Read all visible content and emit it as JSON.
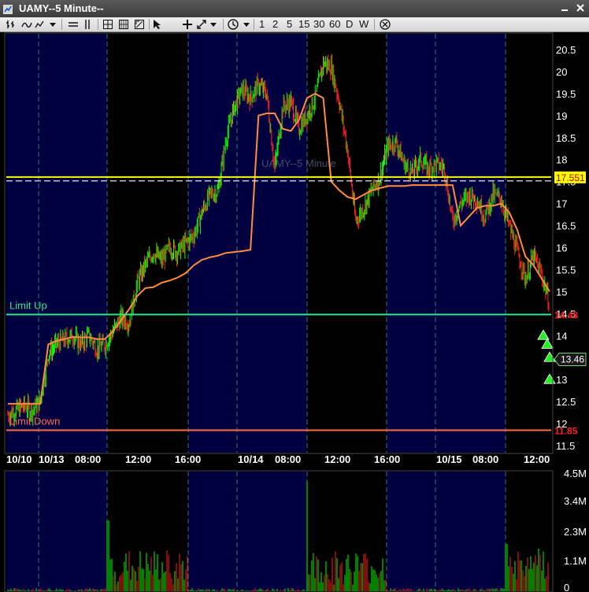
{
  "window": {
    "title": "UAMY--5 Minute--"
  },
  "toolbar": {
    "periods": [
      "1",
      "2",
      "5",
      "15",
      "30",
      "60",
      "D",
      "W"
    ]
  },
  "colors": {
    "background": "#000000",
    "session_band": "#000040",
    "price_up": "#00ff00",
    "price_down": "#ff2020",
    "vwap": "#ff8c40",
    "yellow_line": "#ffff00",
    "limit_up": "#2ee88a",
    "limit_down": "#ff6a4a",
    "triangle": "#22ee22"
  },
  "chart_data": {
    "type": "line",
    "symbol": "UAMY",
    "interval": "5 Minute",
    "watermark": "UAMY--5 Minute",
    "ylim": [
      11.4,
      20.8
    ],
    "y_ticks": [
      "20.5",
      "20",
      "19.5",
      "19",
      "18.5",
      "18",
      "17.5",
      "17",
      "16.5",
      "16",
      "15.5",
      "15",
      "14.5",
      "14",
      "13.5",
      "13",
      "12.5",
      "12",
      "11.5"
    ],
    "x_ticks": [
      "10/10",
      "10/13",
      "08:00",
      "12:00",
      "16:00",
      "10/14",
      "08:00",
      "12:00",
      "16:00",
      "10/15",
      "08:00",
      "12:00"
    ],
    "price_series": {
      "name": "price",
      "values": [
        12.2,
        12.3,
        12.4,
        12.3,
        12.5,
        13.6,
        13.8,
        13.9,
        14.0,
        13.8,
        14.0,
        13.7,
        13.8,
        14.1,
        14.4,
        14.3,
        15.2,
        15.6,
        15.9,
        15.7,
        16.0,
        15.9,
        16.1,
        16.3,
        16.8,
        17.2,
        17.3,
        18.5,
        19.2,
        19.6,
        19.4,
        19.7,
        19.5,
        17.8,
        19.2,
        19.3,
        18.7,
        19.0,
        19.4,
        20.2,
        20.1,
        19.3,
        18.2,
        16.6,
        16.9,
        17.3,
        17.6,
        18.3,
        18.4,
        17.9,
        17.7,
        18.0,
        17.8,
        17.9,
        17.8,
        16.6,
        17.0,
        17.2,
        17.1,
        16.7,
        17.2,
        17.1,
        16.5,
        15.9,
        15.3,
        15.8,
        15.4,
        14.7
      ]
    },
    "vwap_series": {
      "name": "vwap",
      "values": [
        12.45,
        12.45,
        12.45,
        12.45,
        12.45,
        13.8,
        13.88,
        13.92,
        13.97,
        13.96,
        13.96,
        13.92,
        13.92,
        14.1,
        14.35,
        14.6,
        14.9,
        15.08,
        15.1,
        15.2,
        15.25,
        15.32,
        15.42,
        15.6,
        15.72,
        15.78,
        15.82,
        15.88,
        15.9,
        15.92,
        15.95,
        19.0,
        19.05,
        19.05,
        18.7,
        18.65,
        18.9,
        19.4,
        19.5,
        19.4,
        17.5,
        17.3,
        17.15,
        17.1,
        17.2,
        17.3,
        17.35,
        17.4,
        17.4,
        17.4,
        17.42,
        17.42,
        17.42,
        17.42,
        17.42,
        17.42,
        16.5,
        16.7,
        16.9,
        16.95,
        16.95,
        17.0,
        16.8,
        16.4,
        15.8,
        15.6,
        15.3,
        15.0
      ]
    },
    "volume": {
      "y_ticks": [
        "4.5M",
        "3.4M",
        "2.3M",
        "1.1M",
        "0"
      ]
    },
    "levels": [
      {
        "name": "yellow-level",
        "value": 17.551,
        "label": "17.551"
      },
      {
        "name": "limit-up",
        "value": 14.48,
        "label": "14.48",
        "text": "Limit Up"
      },
      {
        "name": "limit-down",
        "value": 11.85,
        "label": "11.85",
        "text": "Limit Down"
      }
    ],
    "last_price": "13.46",
    "markers": [
      14.0,
      13.8,
      13.5,
      13.0
    ]
  }
}
